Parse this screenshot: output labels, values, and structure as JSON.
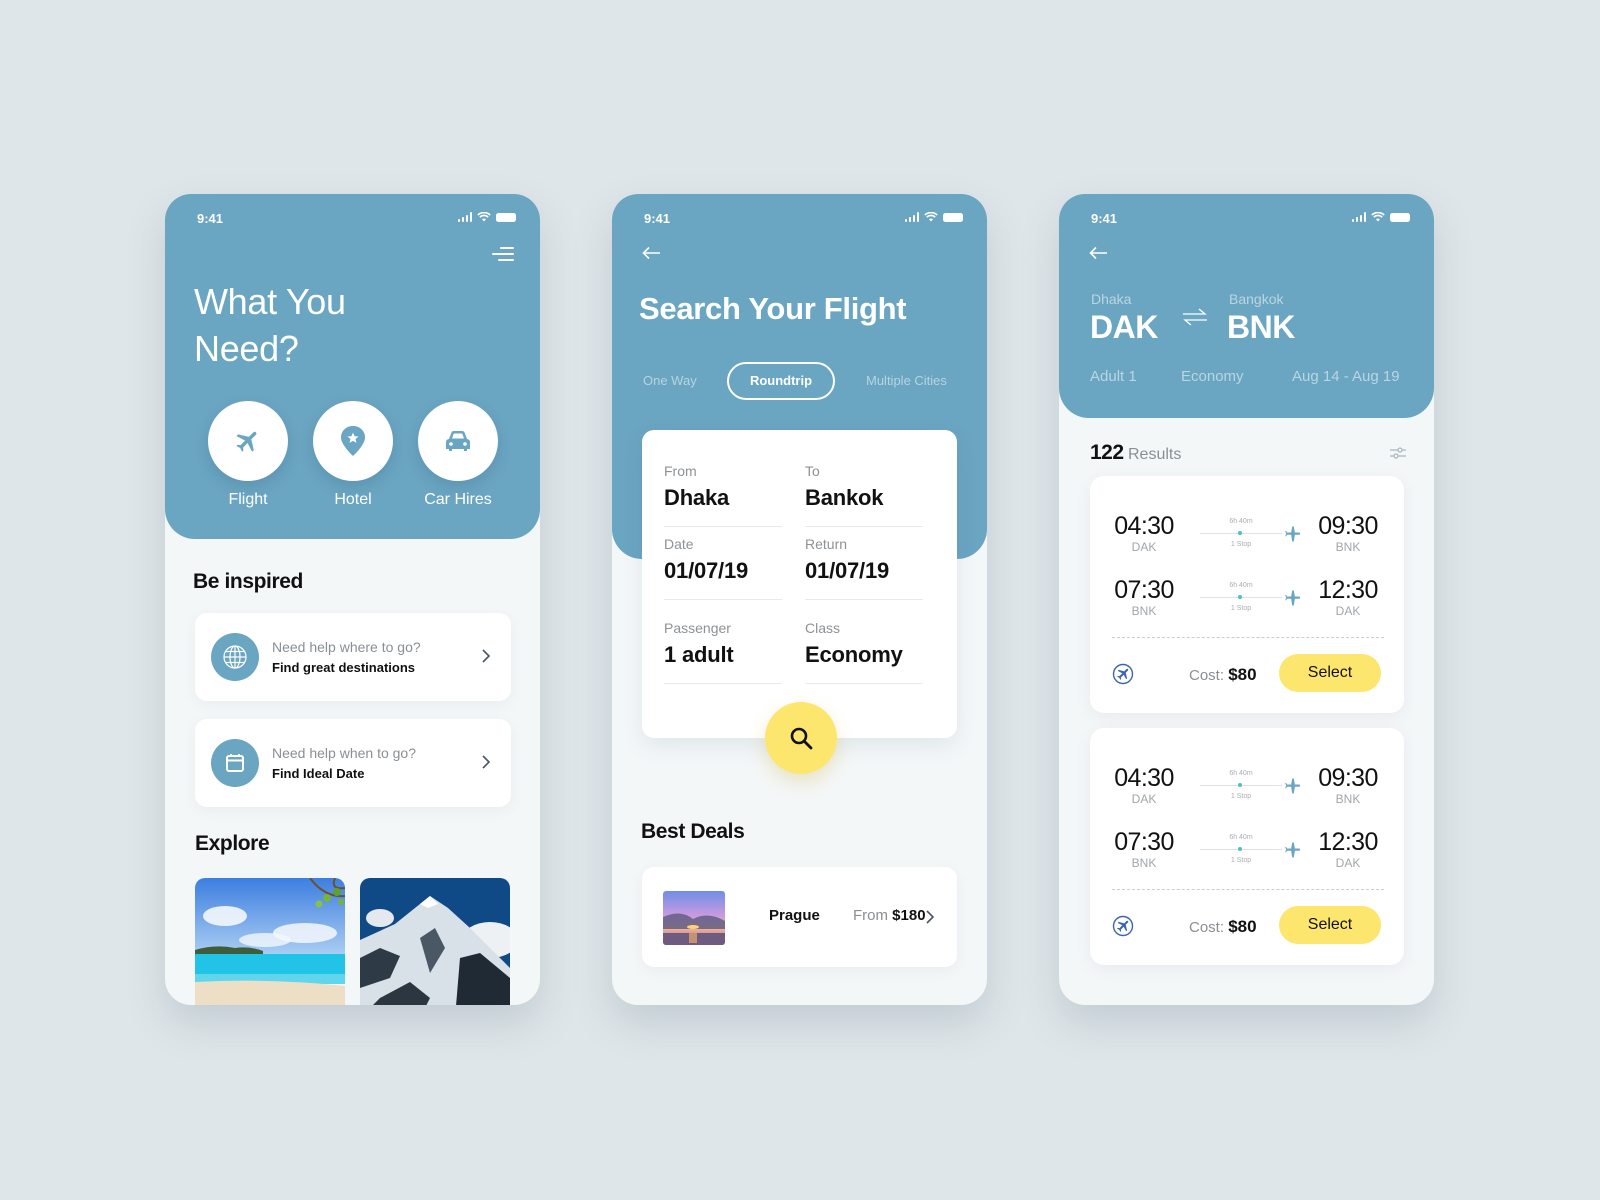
{
  "status_bar": {
    "time": "9:41"
  },
  "home": {
    "title_line1": "What You",
    "title_line2": "Need?",
    "categories": [
      {
        "label": "Flight",
        "icon": "airplane-icon"
      },
      {
        "label": "Hotel",
        "icon": "map-pin-star-icon"
      },
      {
        "label": "Car Hires",
        "icon": "car-icon"
      }
    ],
    "inspired_title": "Be inspired",
    "inspired_items": [
      {
        "question": "Need help where to go?",
        "action": "Find great destinations",
        "icon": "globe-icon"
      },
      {
        "question": "Need help when to go?",
        "action": "Find Ideal Date",
        "icon": "calendar-icon"
      }
    ],
    "explore_title": "Explore",
    "explore_images": [
      {
        "subject": "tropical beach"
      },
      {
        "subject": "snowy mountain peak"
      }
    ]
  },
  "search": {
    "title": "Search Your Flight",
    "trip_types": [
      "One Way",
      "Roundtrip",
      "Multiple Cities"
    ],
    "selected_trip_type": "Roundtrip",
    "fields": {
      "from": {
        "label": "From",
        "value": "Dhaka"
      },
      "to": {
        "label": "To",
        "value": "Bankok"
      },
      "date": {
        "label": "Date",
        "value": "01/07/19"
      },
      "return": {
        "label": "Return",
        "value": "01/07/19"
      },
      "passenger": {
        "label": "Passenger",
        "value": "1 adult"
      },
      "class": {
        "label": "Class",
        "value": "Economy"
      }
    },
    "best_deals_title": "Best Deals",
    "deal": {
      "city": "Prague",
      "price_prefix": "From",
      "price": "$180"
    }
  },
  "results": {
    "from_city": "Dhaka",
    "from_code": "DAK",
    "to_city": "Bangkok",
    "to_code": "BNK",
    "adults": "Adult 1",
    "cabin": "Economy",
    "dates": "Aug 14 - Aug 19",
    "count": "122",
    "count_label": "Results",
    "flights": [
      {
        "legs": [
          {
            "dep_time": "04:30",
            "dep_code": "DAK",
            "duration": "6h 40m",
            "stops": "1 Stop",
            "arr_time": "09:30",
            "arr_code": "BNK"
          },
          {
            "dep_time": "07:30",
            "dep_code": "BNK",
            "duration": "6h 40m",
            "stops": "1 Stop",
            "arr_time": "12:30",
            "arr_code": "DAK"
          }
        ],
        "cost_label": "Cost:",
        "cost": "$80",
        "select_label": "Select"
      },
      {
        "legs": [
          {
            "dep_time": "04:30",
            "dep_code": "DAK",
            "duration": "6h 40m",
            "stops": "1 Stop",
            "arr_time": "09:30",
            "arr_code": "BNK"
          },
          {
            "dep_time": "07:30",
            "dep_code": "BNK",
            "duration": "6h 40m",
            "stops": "1 Stop",
            "arr_time": "12:30",
            "arr_code": "DAK"
          }
        ],
        "cost_label": "Cost:",
        "cost": "$80",
        "select_label": "Select"
      }
    ]
  },
  "colors": {
    "primary": "#6aa5c2",
    "accent": "#fde66e",
    "background": "#dfe6e9",
    "screen_bg": "#f4f7f8",
    "stop_dot": "#4fc1b7"
  }
}
